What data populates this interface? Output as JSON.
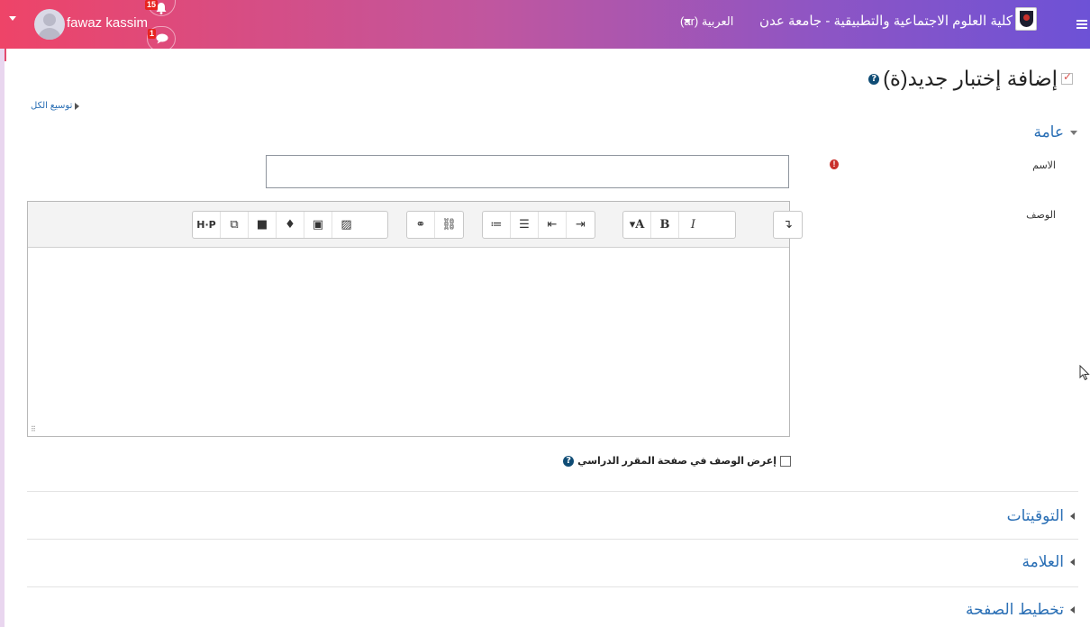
{
  "navbar": {
    "username": "fawaz kassim",
    "notifications_count": "15",
    "messages_count": "1",
    "language": "العربية (ar)",
    "site_name": "كلية العلوم الاجتماعية والتطبيقية - جامعة عدن"
  },
  "page": {
    "title": "إضافة إختبار جديد(ة)",
    "expand_all": "توسيع الكل"
  },
  "form": {
    "general_section": "عامة",
    "name_label": "الاسم",
    "name_value": "",
    "description_label": "الوصف",
    "show_description_label": "إعرض الوصف في صفحة المقرر الدراسي",
    "editor_toolbar": [
      "↴",
      "A",
      "B",
      "I",
      "list-ul",
      "list-ol",
      "outdent",
      "indent",
      "link",
      "unlink",
      "image",
      "media-file",
      "microphone",
      "video",
      "manage-files",
      "H5P"
    ]
  },
  "sections": {
    "timing": "التوقيتات",
    "grade": "العلامة",
    "layout": "تخطيط الصفحة"
  },
  "colors": {
    "navbar_start": "#ee4468",
    "navbar_end": "#6d52d6",
    "link": "#2a6fb5",
    "required": "#c9302c"
  }
}
